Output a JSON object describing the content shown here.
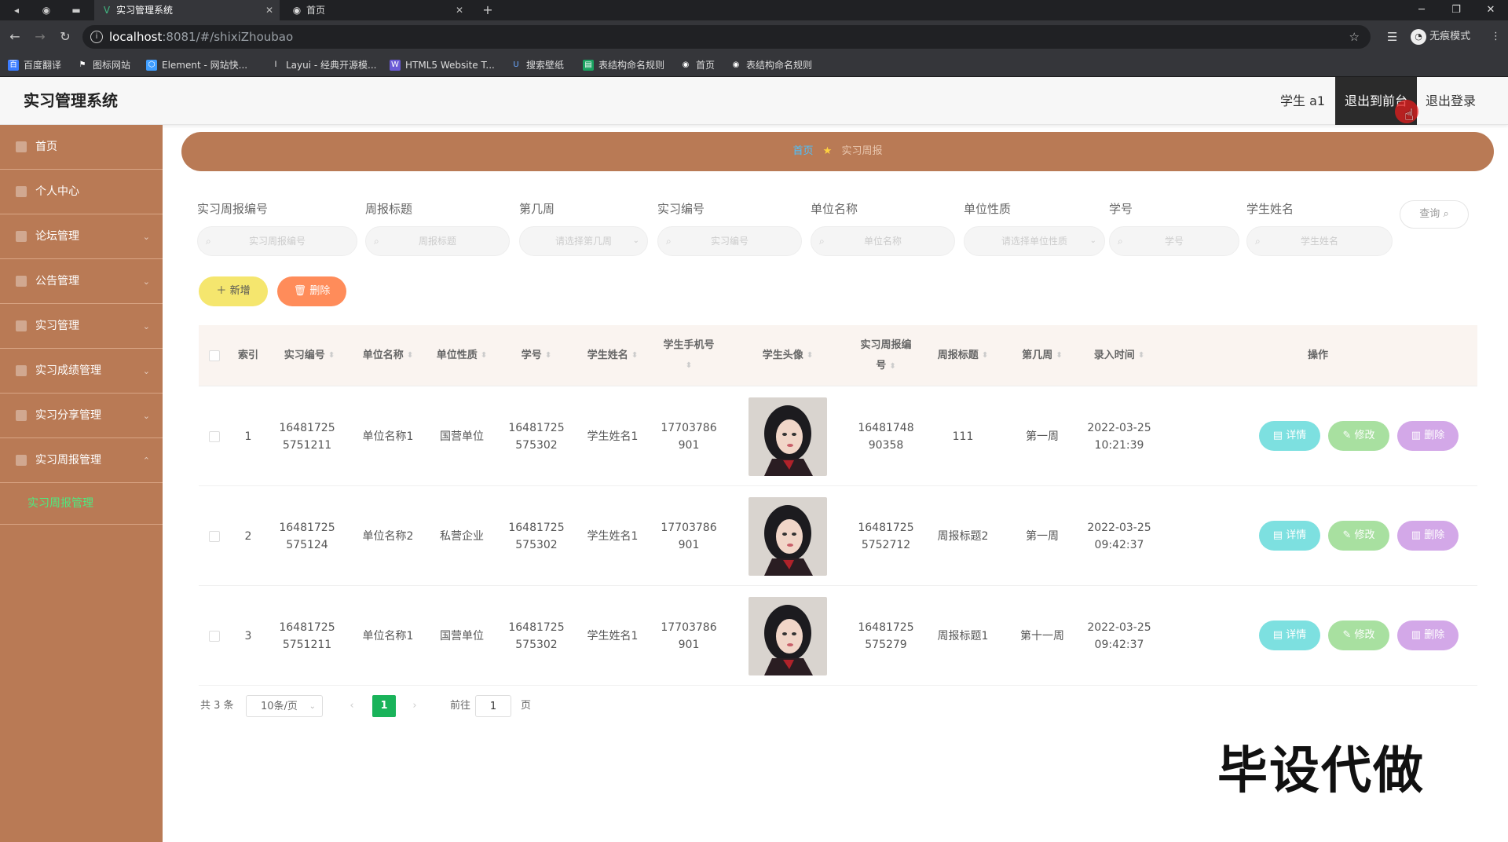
{
  "browser": {
    "tabs": [
      {
        "title": "实习管理系统",
        "icon": "V",
        "active": true
      },
      {
        "title": "首页",
        "icon": "◉",
        "active": false
      }
    ],
    "url_host": "localhost",
    "url_path": ":8081/#/shixiZhoubao",
    "incognito_label": "无痕模式",
    "bookmarks": [
      "百度翻译",
      "图标网站",
      "Element - 网站快...",
      "Layui - 经典开源模...",
      "HTML5 Website T...",
      "搜索壁纸",
      "表结构命名规则",
      "首页",
      "表结构命名规则"
    ]
  },
  "header": {
    "title": "实习管理系统",
    "user": "学生 a1",
    "front_button": "退出到前台",
    "logout": "退出登录"
  },
  "sidebar": {
    "items": [
      {
        "label": "首页"
      },
      {
        "label": "个人中心"
      },
      {
        "label": "论坛管理"
      },
      {
        "label": "公告管理"
      },
      {
        "label": "实习管理"
      },
      {
        "label": "实习成绩管理"
      },
      {
        "label": "实习分享管理"
      },
      {
        "label": "实习周报管理"
      }
    ],
    "active_sub": "实习周报管理"
  },
  "breadcrumb": {
    "home": "首页",
    "current": "实习周报"
  },
  "search": {
    "fields": [
      {
        "label": "实习周报编号",
        "placeholder": "实习周报编号"
      },
      {
        "label": "周报标题",
        "placeholder": "周报标题"
      },
      {
        "label": "第几周",
        "placeholder": "请选择第几周"
      },
      {
        "label": "实习编号",
        "placeholder": "实习编号"
      },
      {
        "label": "单位名称",
        "placeholder": "单位名称"
      },
      {
        "label": "单位性质",
        "placeholder": "请选择单位性质"
      },
      {
        "label": "学号",
        "placeholder": "学号"
      },
      {
        "label": "学生姓名",
        "placeholder": "学生姓名"
      }
    ],
    "query_button": "查询"
  },
  "actions": {
    "add": "新增",
    "delete": "删除"
  },
  "table": {
    "headers": {
      "index": "索引",
      "intern_no": "实习编号",
      "unit_name": "单位名称",
      "unit_type": "单位性质",
      "student_no": "学号",
      "student_name": "学生姓名",
      "phone": "学生手机号",
      "avatar": "学生头像",
      "report_no": "实习周报编号",
      "report_title": "周报标题",
      "week": "第几周",
      "created": "录入时间",
      "ops": "操作"
    },
    "rows": [
      {
        "index": "1",
        "intern_no": "164817255751211",
        "unit_name": "单位名称1",
        "unit_type": "国营单位",
        "student_no": "16481725575302",
        "student_name": "学生姓名1",
        "phone": "17703786901",
        "report_no": "1648174890358",
        "report_title": "111",
        "week": "第一周",
        "created_date": "2022-03-25",
        "created_time": "10:21:39"
      },
      {
        "index": "2",
        "intern_no": "16481725575124",
        "unit_name": "单位名称2",
        "unit_type": "私营企业",
        "student_no": "16481725575302",
        "student_name": "学生姓名1",
        "phone": "17703786901",
        "report_no": "164817255752712",
        "report_title": "周报标题2",
        "week": "第一周",
        "created_date": "2022-03-25",
        "created_time": "09:42:37"
      },
      {
        "index": "3",
        "intern_no": "164817255751211",
        "unit_name": "单位名称1",
        "unit_type": "国营单位",
        "student_no": "16481725575302",
        "student_name": "学生姓名1",
        "phone": "17703786901",
        "report_no": "16481725575279",
        "report_title": "周报标题1",
        "week": "第十一周",
        "created_date": "2022-03-25",
        "created_time": "09:42:37"
      }
    ],
    "row_actions": {
      "detail": "详情",
      "edit": "修改",
      "remove": "删除"
    }
  },
  "pagination": {
    "total": "共 3 条",
    "page_size": "10条/页",
    "current_page": "1",
    "goto_prefix": "前往",
    "goto_value": "1",
    "goto_suffix": "页"
  },
  "watermark": "毕设代做",
  "colors": {
    "sidebar": "#b97a55",
    "active_green": "#19b35a",
    "add_button": "#f5e66e",
    "delete_button": "#ff8c5a"
  }
}
